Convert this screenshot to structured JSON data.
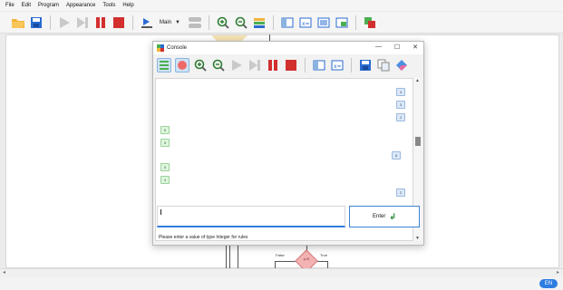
{
  "menubar": {
    "items": [
      "File",
      "Edit",
      "Program",
      "Appearance",
      "Tools",
      "Help"
    ]
  },
  "toolbar": {
    "function_select": "Main"
  },
  "diagram": {
    "condition": "y>5",
    "false_label": "False",
    "true_label": "True"
  },
  "status": {
    "language": "EN"
  },
  "console": {
    "title": "Console",
    "window_buttons": {
      "minimize": "—",
      "maximize": "☐",
      "close": "✕"
    },
    "output_values": [
      "4",
      "3",
      "2",
      "6",
      "5",
      "6",
      "5",
      "4",
      "2"
    ],
    "input": {
      "value": ""
    },
    "enter_label": "Enter",
    "status_message": "Please enter a value of type Integer for rules"
  },
  "colors": {
    "accent": "#2f7de1",
    "input_chip": "#dff5df",
    "output_chip": "#dce8f8"
  }
}
